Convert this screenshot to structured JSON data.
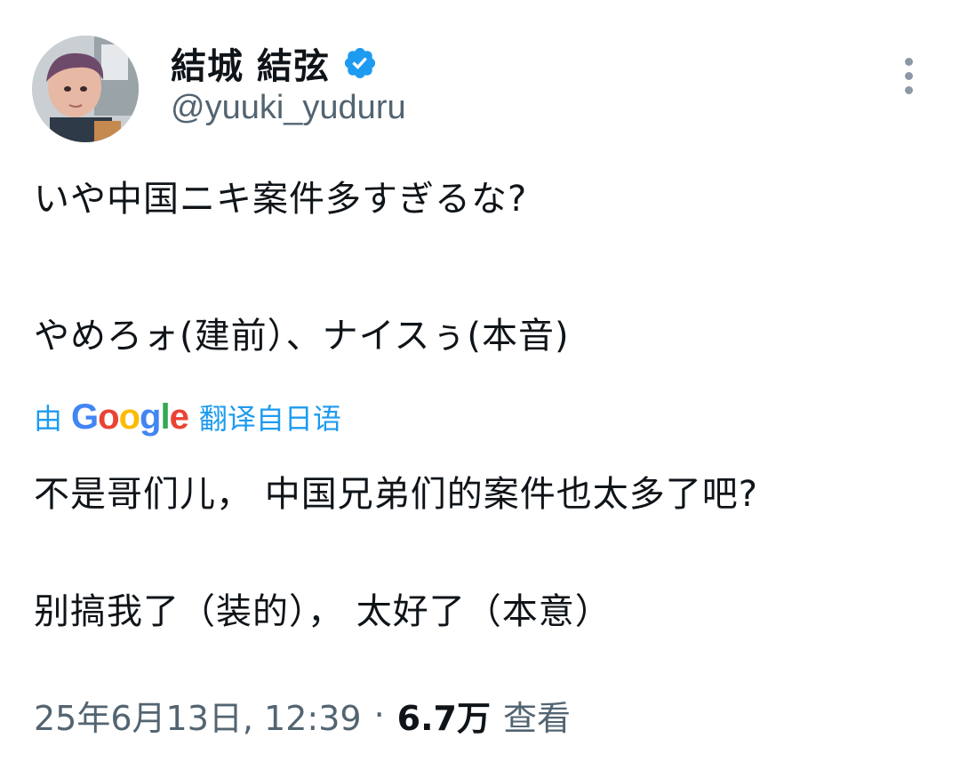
{
  "author": {
    "display_name": "結城 結弦",
    "handle": "@yuuki_yuduru",
    "verified": true,
    "verified_color": "#1d9bf0"
  },
  "tweet": {
    "original_lines": [
      "いや中国ニキ案件多すぎるな?",
      "やめろォ(建前）、ナイスぅ(本音)"
    ],
    "translation_label": {
      "prefix": "由",
      "brand": "Google",
      "suffix": "翻译自日语"
    },
    "translated_lines": [
      "不是哥们儿， 中国兄弟们的案件也太多了吧?",
      "别搞我了（装的）， 太好了（本意）"
    ]
  },
  "meta": {
    "timestamp": "25年6月13日, 12:39",
    "separator": "·",
    "views_count": "6.7万",
    "views_label": "查看"
  },
  "icons": {
    "more": "more-vertical-icon",
    "verified": "verified-badge-icon"
  },
  "colors": {
    "text_primary": "#0f1419",
    "text_secondary": "#536471",
    "accent": "#1d9bf0",
    "google_blue": "#4285f4",
    "google_red": "#ea4335",
    "google_yellow": "#fbbc05",
    "google_green": "#34a853"
  }
}
